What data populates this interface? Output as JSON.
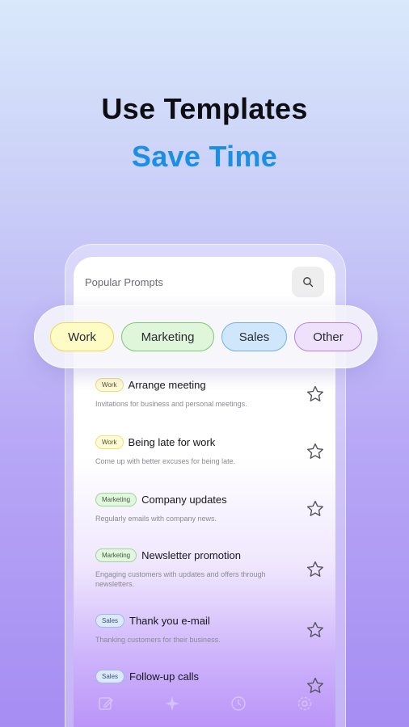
{
  "headline": {
    "line1": "Use Templates",
    "line2": "Save Time"
  },
  "screen": {
    "title": "Popular Prompts"
  },
  "filters": [
    "Work",
    "Marketing",
    "Sales",
    "Other"
  ],
  "prompts": [
    {
      "tag": "Work",
      "title": "Arrange meeting",
      "description": "Invitations for business and personal meetings."
    },
    {
      "tag": "Work",
      "title": "Being late for work",
      "description": "Come up with better excuses for being late."
    },
    {
      "tag": "Marketing",
      "title": "Company updates",
      "description": "Regularly emails with company news."
    },
    {
      "tag": "Marketing",
      "title": "Newsletter promotion",
      "description": "Engaging customers with updates and offers through newsletters."
    },
    {
      "tag": "Sales",
      "title": "Thank you e-mail",
      "description": "Thanking customers for their business."
    },
    {
      "tag": "Sales",
      "title": "Follow-up calls",
      "description": ""
    }
  ],
  "icons": {
    "search": "search-icon",
    "star": "star-outline-icon",
    "tab_write": "edit-icon",
    "tab_sparkle": "sparkle-icon",
    "tab_history": "history-icon",
    "tab_settings": "gear-icon"
  },
  "colors": {
    "headline_dark": "#0d0d12",
    "headline_accent": "#1a8fe3",
    "work": "#fffbc4",
    "marketing": "#dff6da",
    "sales": "#cfe6fb",
    "other": "#efe1fb"
  }
}
